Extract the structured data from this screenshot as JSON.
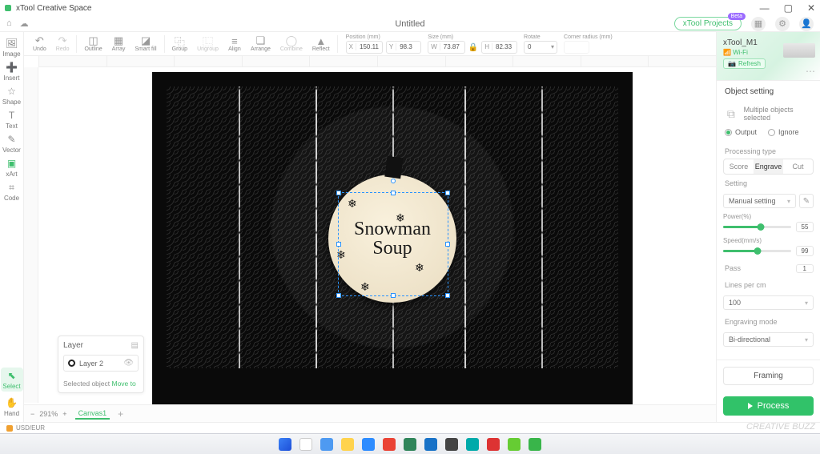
{
  "app": {
    "name": "xTool Creative Space"
  },
  "window": {
    "min": "—",
    "max": "▢",
    "close": "✕"
  },
  "header": {
    "house": "⌂",
    "cloud": "☁",
    "title": "Untitled",
    "projects": "xTool Projects",
    "projects_badge": "Beta"
  },
  "lefttools": {
    "image": "Image",
    "insert": "Insert",
    "shape": "Shape",
    "text": "Text",
    "vector": "Vector",
    "xart": "xArt",
    "code": "Code",
    "select": "Select",
    "hand": "Hand"
  },
  "toolbar": {
    "undo": "Undo",
    "redo": "Redo",
    "outline": "Outline",
    "array": "Array",
    "smartfill": "Smart fill",
    "group": "Group",
    "ungroup": "Ungroup",
    "align": "Align",
    "arrange": "Arrange",
    "combine": "Combine",
    "reflect": "Reflect",
    "pos_lbl": "Position (mm)",
    "x": "150.11",
    "y": "98.3",
    "size_lbl": "Size (mm)",
    "w": "73.87",
    "h": "82.33",
    "rot_lbl": "Rotate",
    "rot": "0",
    "corner_lbl": "Corner radius (mm)"
  },
  "canvas": {
    "design_line1": "Snowman",
    "design_line2": "Soup",
    "tab": "Canvas1",
    "zoom": "291%"
  },
  "layer": {
    "title": "Layer",
    "item": "Layer 2",
    "footer_a": "Selected object ",
    "footer_b": "Move to"
  },
  "right": {
    "device": "xTool_M1",
    "conn": "Wi-Fi",
    "refresh": "Refresh",
    "objset": "Object setting",
    "multi": "Multiple objects selected",
    "output": "Output",
    "ignore": "Ignore",
    "proctype": "Processing type",
    "score": "Score",
    "engrave": "Engrave",
    "cut": "Cut",
    "setting": "Setting",
    "manual": "Manual setting",
    "power_lbl": "Power(%)",
    "power": "55",
    "speed_lbl": "Speed(mm/s)",
    "speed": "99",
    "pass_lbl": "Pass",
    "pass": "1",
    "lpc_lbl": "Lines per cm",
    "lpc": "100",
    "mode_lbl": "Engraving mode",
    "mode": "Bi-directional",
    "framing": "Framing",
    "process": "Process"
  },
  "status": {
    "currency": "USD/EUR"
  },
  "brand": "CREATIVE BUZZ"
}
